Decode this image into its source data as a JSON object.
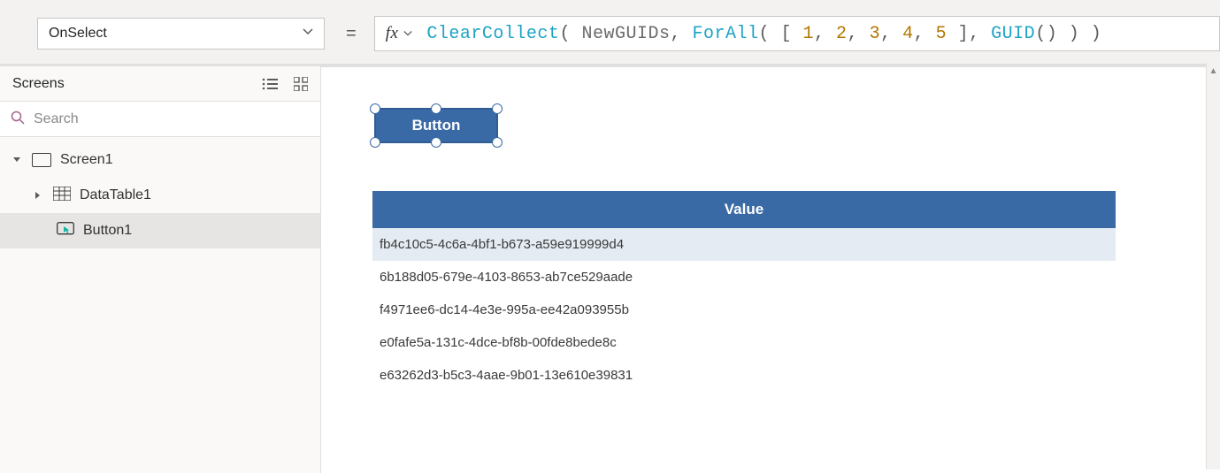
{
  "formula_bar": {
    "property": "OnSelect",
    "equals": "=",
    "fx": "fx",
    "formula_tokens": [
      {
        "t": "fn",
        "v": "ClearCollect"
      },
      {
        "t": "br",
        "v": "( "
      },
      {
        "t": "id",
        "v": "NewGUIDs"
      },
      {
        "t": "sep",
        "v": ", "
      },
      {
        "t": "fn",
        "v": "ForAll"
      },
      {
        "t": "br",
        "v": "( [ "
      },
      {
        "t": "num",
        "v": "1"
      },
      {
        "t": "sep",
        "v": ", "
      },
      {
        "t": "num",
        "v": "2"
      },
      {
        "t": "sep",
        "v": ", "
      },
      {
        "t": "num",
        "v": "3"
      },
      {
        "t": "sep",
        "v": ", "
      },
      {
        "t": "num",
        "v": "4"
      },
      {
        "t": "sep",
        "v": ", "
      },
      {
        "t": "num",
        "v": "5"
      },
      {
        "t": "br",
        "v": " ], "
      },
      {
        "t": "fn",
        "v": "GUID"
      },
      {
        "t": "br",
        "v": "() ) )"
      }
    ]
  },
  "left_panel": {
    "title": "Screens",
    "search_placeholder": "Search",
    "tree": {
      "screen": "Screen1",
      "datatable": "DataTable1",
      "button": "Button1"
    }
  },
  "canvas": {
    "button_label": "Button",
    "table": {
      "header": "Value",
      "rows": [
        "fb4c10c5-4c6a-4bf1-b673-a59e919999d4",
        "6b188d05-679e-4103-8653-ab7ce529aade",
        "f4971ee6-dc14-4e3e-995a-ee42a093955b",
        "e0fafe5a-131c-4dce-bf8b-00fde8bede8c",
        "e63262d3-b5c3-4aae-9b01-13e610e39831"
      ]
    }
  }
}
